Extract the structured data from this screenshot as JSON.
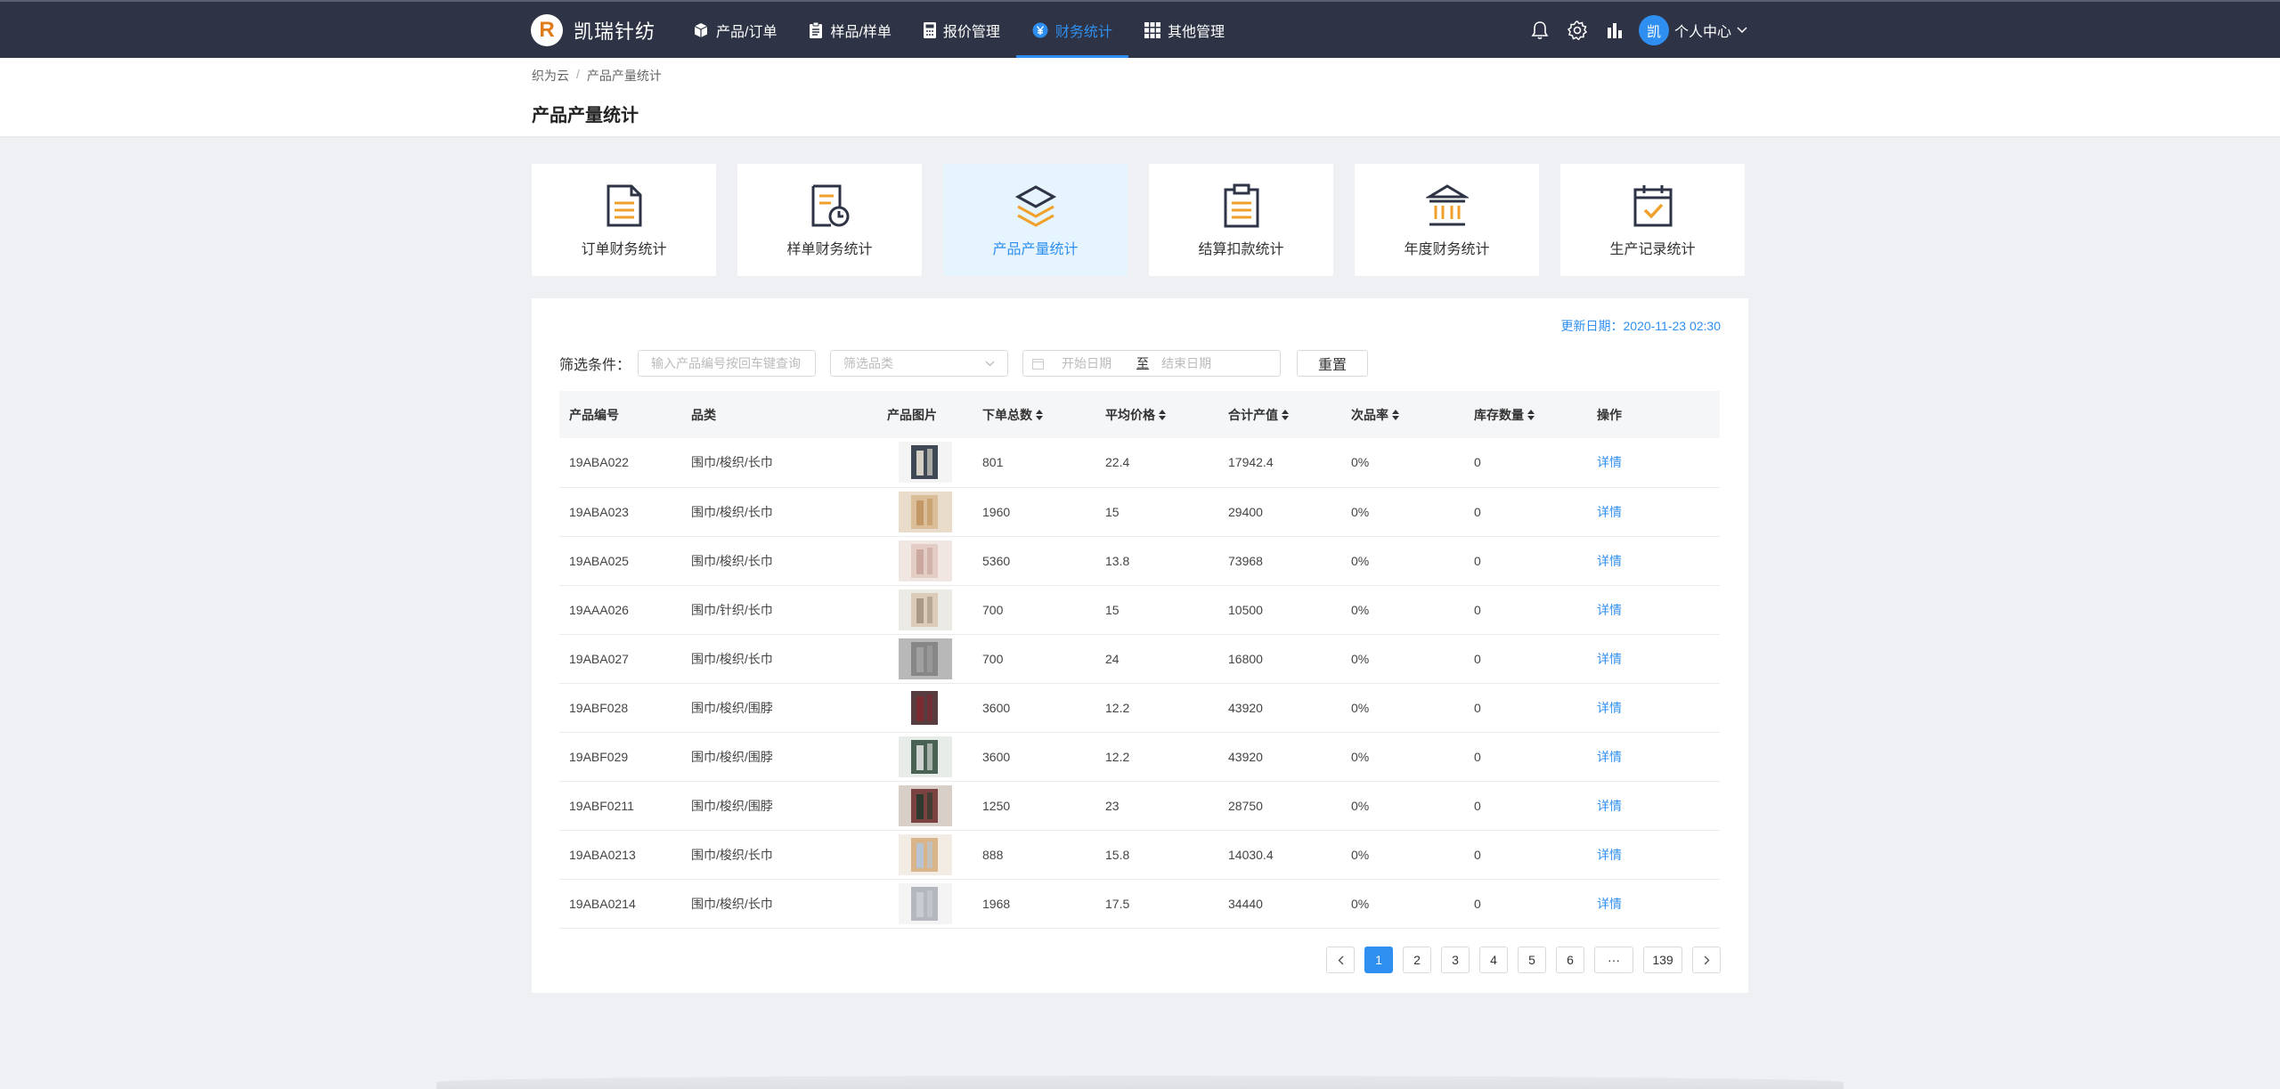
{
  "brand": {
    "logo": "R",
    "name": "凯瑞针纺"
  },
  "nav": {
    "items": [
      {
        "label": "产品/订单",
        "icon": "box-icon"
      },
      {
        "label": "样品/样单",
        "icon": "clipboard-icon"
      },
      {
        "label": "报价管理",
        "icon": "calculator-icon"
      },
      {
        "label": "财务统计",
        "icon": "yen-circle-icon",
        "active": true
      },
      {
        "label": "其他管理",
        "icon": "grid-icon"
      }
    ],
    "user": {
      "avatar": "凯",
      "label": "个人中心"
    }
  },
  "breadcrumb": {
    "root": "织为云",
    "sep": "/",
    "current": "产品产量统计"
  },
  "page_title": "产品产量统计",
  "cards": [
    {
      "label": "订单财务统计",
      "icon": "document-list-icon"
    },
    {
      "label": "样单财务统计",
      "icon": "document-clock-icon"
    },
    {
      "label": "产品产量统计",
      "icon": "layers-icon",
      "active": true
    },
    {
      "label": "结算扣款统计",
      "icon": "clipboard-list-icon"
    },
    {
      "label": "年度财务统计",
      "icon": "bank-icon"
    },
    {
      "label": "生产记录统计",
      "icon": "calendar-check-icon"
    }
  ],
  "update_date": "更新日期：2020-11-23 02:30",
  "filter": {
    "label": "筛选条件：",
    "search_placeholder": "输入产品编号按回车键查询",
    "category_placeholder": "筛选品类",
    "start_date": "开始日期",
    "range_sep": "至",
    "end_date": "结束日期",
    "reset": "重置"
  },
  "table": {
    "headers": [
      "产品编号",
      "品类",
      "产品图片",
      "下单总数",
      "平均价格",
      "合计产值",
      "次品率",
      "库存数量",
      "操作"
    ],
    "detail_label": "详情",
    "rows": [
      {
        "code": "19ABA022",
        "category": "围巾/梭织/长巾",
        "qty": "801",
        "price": "22.4",
        "total": "17942.4",
        "defect": "0%",
        "stock": "0"
      },
      {
        "code": "19ABA023",
        "category": "围巾/梭织/长巾",
        "qty": "1960",
        "price": "15",
        "total": "29400",
        "defect": "0%",
        "stock": "0"
      },
      {
        "code": "19ABA025",
        "category": "围巾/梭织/长巾",
        "qty": "5360",
        "price": "13.8",
        "total": "73968",
        "defect": "0%",
        "stock": "0"
      },
      {
        "code": "19AAA026",
        "category": "围巾/针织/长巾",
        "qty": "700",
        "price": "15",
        "total": "10500",
        "defect": "0%",
        "stock": "0"
      },
      {
        "code": "19ABA027",
        "category": "围巾/梭织/长巾",
        "qty": "700",
        "price": "24",
        "total": "16800",
        "defect": "0%",
        "stock": "0"
      },
      {
        "code": "19ABF028",
        "category": "围巾/梭织/围脖",
        "qty": "3600",
        "price": "12.2",
        "total": "43920",
        "defect": "0%",
        "stock": "0"
      },
      {
        "code": "19ABF029",
        "category": "围巾/梭织/围脖",
        "qty": "3600",
        "price": "12.2",
        "total": "43920",
        "defect": "0%",
        "stock": "0"
      },
      {
        "code": "19ABF0211",
        "category": "围巾/梭织/围脖",
        "qty": "1250",
        "price": "23",
        "total": "28750",
        "defect": "0%",
        "stock": "0"
      },
      {
        "code": "19ABA0213",
        "category": "围巾/梭织/长巾",
        "qty": "888",
        "price": "15.8",
        "total": "14030.4",
        "defect": "0%",
        "stock": "0"
      },
      {
        "code": "19ABA0214",
        "category": "围巾/梭织/长巾",
        "qty": "1968",
        "price": "17.5",
        "total": "34440",
        "defect": "0%",
        "stock": "0"
      }
    ]
  },
  "pagination": {
    "pages": [
      "1",
      "2",
      "3",
      "4",
      "5",
      "6"
    ],
    "ellipsis": "···",
    "last": "139",
    "current": "1"
  },
  "colors": {
    "accent": "#2f8ff0",
    "nav_bg": "#2e3445",
    "card_icon_accent": "#f0a12c"
  }
}
